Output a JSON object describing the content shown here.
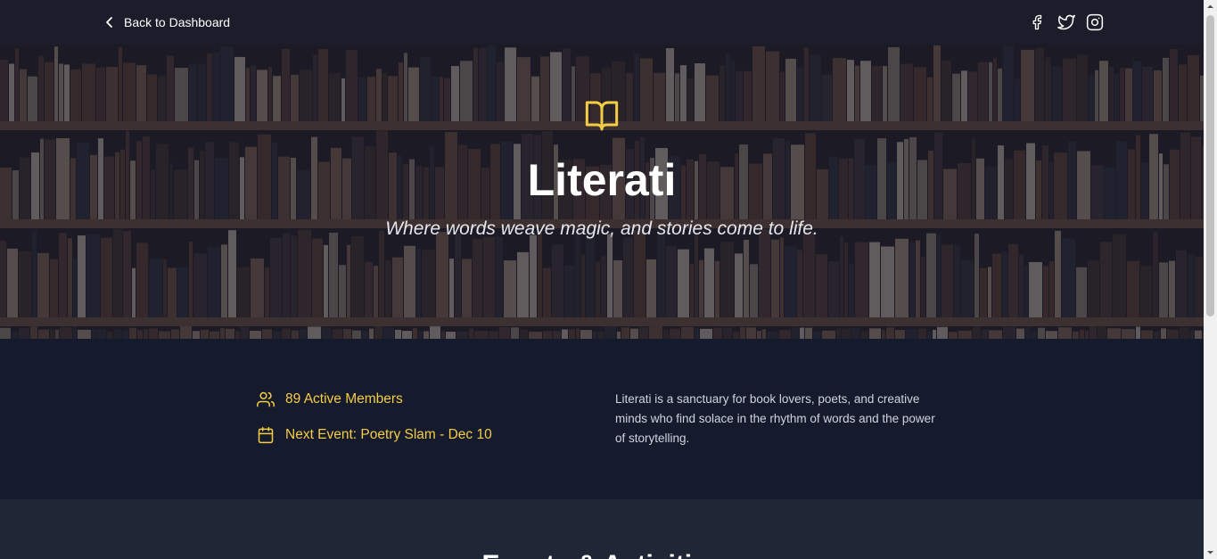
{
  "nav": {
    "back_label": "Back to Dashboard",
    "social": [
      "facebook-icon",
      "twitter-icon",
      "instagram-icon"
    ]
  },
  "hero": {
    "icon": "book-open-icon",
    "title": "Literati",
    "tagline": "Where words weave magic, and stories come to life."
  },
  "stats": {
    "members": "89 Active Members",
    "event": "Next Event: Poetry Slam - Dec 10"
  },
  "about": {
    "description": "Literati is a sanctuary for book lovers, poets, and creative minds who find solace in the rhythm of words and the power of storytelling."
  },
  "events_section": {
    "title": "Events & Activities"
  },
  "colors": {
    "accent": "#f5cd45",
    "background": "#151a2d",
    "events_background": "#1f2737"
  }
}
